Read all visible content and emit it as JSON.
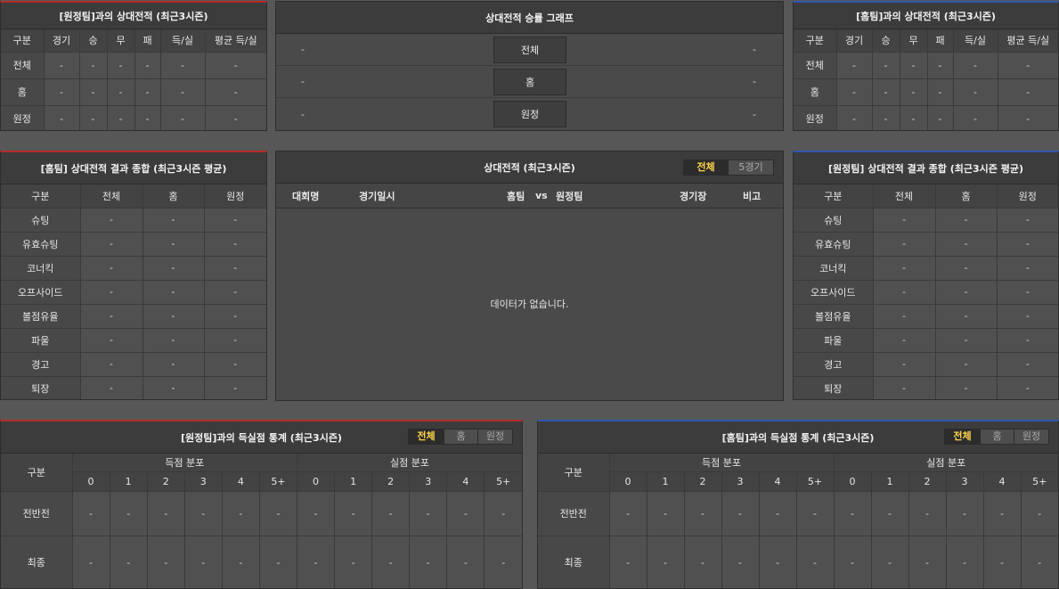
{
  "h2h_away": {
    "title": "[원정팀]과의 상대전적 (최근3시즌)",
    "cols": [
      "구분",
      "경기",
      "승",
      "무",
      "패",
      "득/실",
      "평균 득/실"
    ],
    "rows": [
      {
        "label": "전체",
        "vals": [
          "-",
          "-",
          "-",
          "-",
          "-",
          "-"
        ]
      },
      {
        "label": "홈",
        "vals": [
          "-",
          "-",
          "-",
          "-",
          "-",
          "-"
        ]
      },
      {
        "label": "원정",
        "vals": [
          "-",
          "-",
          "-",
          "-",
          "-",
          "-"
        ]
      }
    ]
  },
  "graph": {
    "title": "상대전적 승률 그래프",
    "rows": [
      {
        "left": "-",
        "label": "전체",
        "right": "-"
      },
      {
        "left": "-",
        "label": "홈",
        "right": "-"
      },
      {
        "left": "-",
        "label": "원정",
        "right": "-"
      }
    ]
  },
  "h2h_home": {
    "title": "[홈팀]과의 상대전적 (최근3시즌)",
    "cols": [
      "구분",
      "경기",
      "승",
      "무",
      "패",
      "득/실",
      "평균 득/실"
    ],
    "rows": [
      {
        "label": "전체",
        "vals": [
          "-",
          "-",
          "-",
          "-",
          "-",
          "-"
        ]
      },
      {
        "label": "홈",
        "vals": [
          "-",
          "-",
          "-",
          "-",
          "-",
          "-"
        ]
      },
      {
        "label": "원정",
        "vals": [
          "-",
          "-",
          "-",
          "-",
          "-",
          "-"
        ]
      }
    ]
  },
  "summary_home": {
    "title": "[홈팀] 상대전적 결과 종합 (최근3시즌 평균)",
    "cols": [
      "구분",
      "전체",
      "홈",
      "원정"
    ],
    "rows": [
      {
        "label": "슈팅",
        "vals": [
          "-",
          "-",
          "-"
        ]
      },
      {
        "label": "유효슈팅",
        "vals": [
          "-",
          "-",
          "-"
        ]
      },
      {
        "label": "코너킥",
        "vals": [
          "-",
          "-",
          "-"
        ]
      },
      {
        "label": "오프사이드",
        "vals": [
          "-",
          "-",
          "-"
        ]
      },
      {
        "label": "볼점유율",
        "vals": [
          "-",
          "-",
          "-"
        ]
      },
      {
        "label": "파울",
        "vals": [
          "-",
          "-",
          "-"
        ]
      },
      {
        "label": "경고",
        "vals": [
          "-",
          "-",
          "-"
        ]
      },
      {
        "label": "퇴장",
        "vals": [
          "-",
          "-",
          "-"
        ]
      }
    ]
  },
  "matches": {
    "title": "상대전적 (최근3시즌)",
    "toggle": [
      "전체",
      "5경기"
    ],
    "cols": {
      "league": "대회명",
      "date": "경기일시",
      "home": "홈팀",
      "vs": "vs",
      "away": "원정팀",
      "stadium": "경기장",
      "note": "비고"
    },
    "empty": "데이터가 없습니다."
  },
  "summary_away": {
    "title": "[원정팀] 상대전적 결과 종합 (최근3시즌 평균)",
    "cols": [
      "구분",
      "전체",
      "홈",
      "원정"
    ],
    "rows": [
      {
        "label": "슈팅",
        "vals": [
          "-",
          "-",
          "-"
        ]
      },
      {
        "label": "유효슈팅",
        "vals": [
          "-",
          "-",
          "-"
        ]
      },
      {
        "label": "코너킥",
        "vals": [
          "-",
          "-",
          "-"
        ]
      },
      {
        "label": "오프사이드",
        "vals": [
          "-",
          "-",
          "-"
        ]
      },
      {
        "label": "볼점유율",
        "vals": [
          "-",
          "-",
          "-"
        ]
      },
      {
        "label": "파울",
        "vals": [
          "-",
          "-",
          "-"
        ]
      },
      {
        "label": "경고",
        "vals": [
          "-",
          "-",
          "-"
        ]
      },
      {
        "label": "퇴장",
        "vals": [
          "-",
          "-",
          "-"
        ]
      }
    ]
  },
  "goals_away": {
    "title": "[원정팀]과의 득실점 통계 (최근3시즌)",
    "toggle": [
      "전체",
      "홈",
      "원정"
    ],
    "label_col": "구분",
    "scored": "득점 분포",
    "conceded": "실점 분포",
    "buckets": [
      "0",
      "1",
      "2",
      "3",
      "4",
      "5+"
    ],
    "rows": [
      {
        "label": "전반전",
        "vals": [
          "-",
          "-",
          "-",
          "-",
          "-",
          "-",
          "-",
          "-",
          "-",
          "-",
          "-",
          "-"
        ]
      },
      {
        "label": "최종",
        "vals": [
          "-",
          "-",
          "-",
          "-",
          "-",
          "-",
          "-",
          "-",
          "-",
          "-",
          "-",
          "-"
        ]
      }
    ]
  },
  "goals_home": {
    "title": "[홈팀]과의 득실점 통계 (최근3시즌)",
    "toggle": [
      "전체",
      "홈",
      "원정"
    ],
    "label_col": "구분",
    "scored": "득점 분포",
    "conceded": "실점 분포",
    "buckets": [
      "0",
      "1",
      "2",
      "3",
      "4",
      "5+"
    ],
    "rows": [
      {
        "label": "전반전",
        "vals": [
          "-",
          "-",
          "-",
          "-",
          "-",
          "-",
          "-",
          "-",
          "-",
          "-",
          "-",
          "-"
        ]
      },
      {
        "label": "최종",
        "vals": [
          "-",
          "-",
          "-",
          "-",
          "-",
          "-",
          "-",
          "-",
          "-",
          "-",
          "-",
          "-"
        ]
      }
    ]
  }
}
